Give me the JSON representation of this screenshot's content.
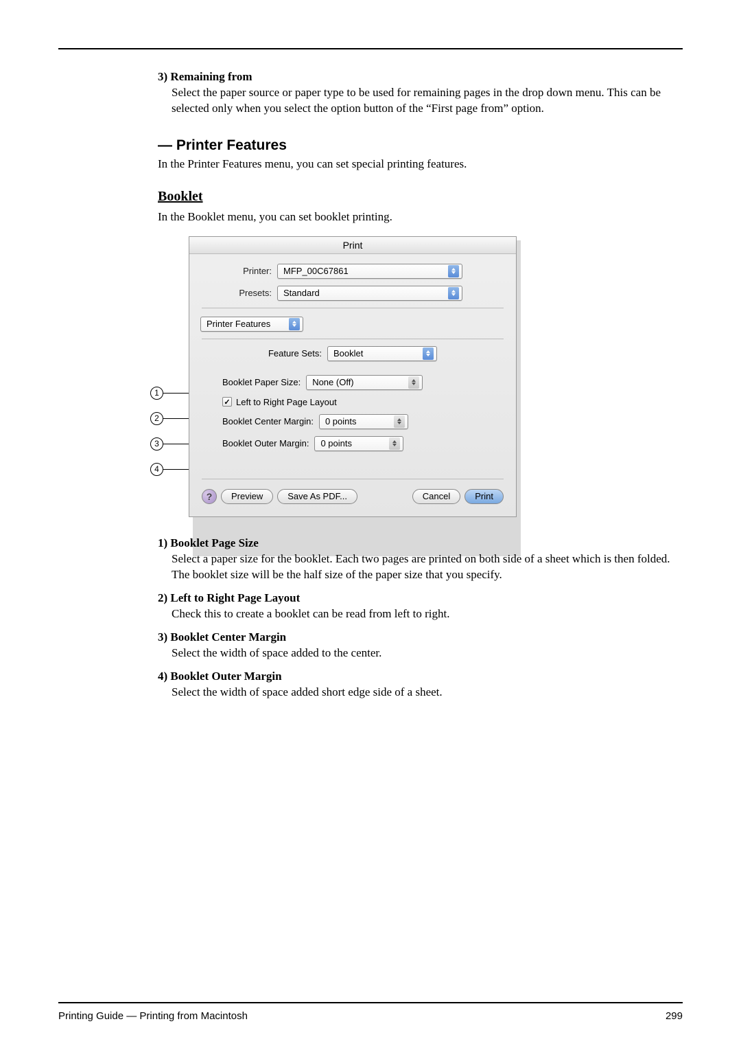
{
  "top_item": {
    "num": "3)",
    "title": "Remaining from",
    "desc": "Select the paper source or paper type to be used for remaining pages in the drop down menu. This can be selected only when you select the option button of the “First page from” option."
  },
  "section": {
    "title": "— Printer Features",
    "desc": "In the Printer Features menu, you can set special printing features."
  },
  "subsection": {
    "title": "Booklet",
    "desc": "In the Booklet menu, you can set booklet printing."
  },
  "dialog": {
    "title": "Print",
    "printer_label": "Printer:",
    "printer_value": "MFP_00C67861",
    "presets_label": "Presets:",
    "presets_value": "Standard",
    "pane_value": "Printer Features",
    "feature_sets_label": "Feature Sets:",
    "feature_sets_value": "Booklet",
    "paper_size_label": "Booklet Paper Size:",
    "paper_size_value": "None (Off)",
    "left_right_label": "Left to Right Page Layout",
    "center_margin_label": "Booklet Center Margin:",
    "center_margin_value": "0 points",
    "outer_margin_label": "Booklet Outer Margin:",
    "outer_margin_value": "0 points",
    "help_label": "?",
    "preview_label": "Preview",
    "save_pdf_label": "Save As PDF...",
    "cancel_label": "Cancel",
    "print_label": "Print"
  },
  "items": {
    "i1": {
      "num": "1)",
      "title": "Booklet Page Size",
      "desc": "Select a paper size for the booklet.  Each two pages are printed on both side of a sheet which is then folded.  The booklet size will be the half size of the paper size that you specify."
    },
    "i2": {
      "num": "2)",
      "title": "Left to Right Page Layout",
      "desc": "Check this to create a booklet can be read from left to right."
    },
    "i3": {
      "num": "3)",
      "title": "Booklet Center Margin",
      "desc": "Select the width of space added to the center."
    },
    "i4": {
      "num": "4)",
      "title": "Booklet Outer Margin",
      "desc": "Select the width of space added short edge side of a sheet."
    }
  },
  "callouts": {
    "c1": "1",
    "c2": "2",
    "c3": "3",
    "c4": "4"
  },
  "footer": {
    "left": "Printing Guide — Printing from Macintosh",
    "right": "299"
  }
}
